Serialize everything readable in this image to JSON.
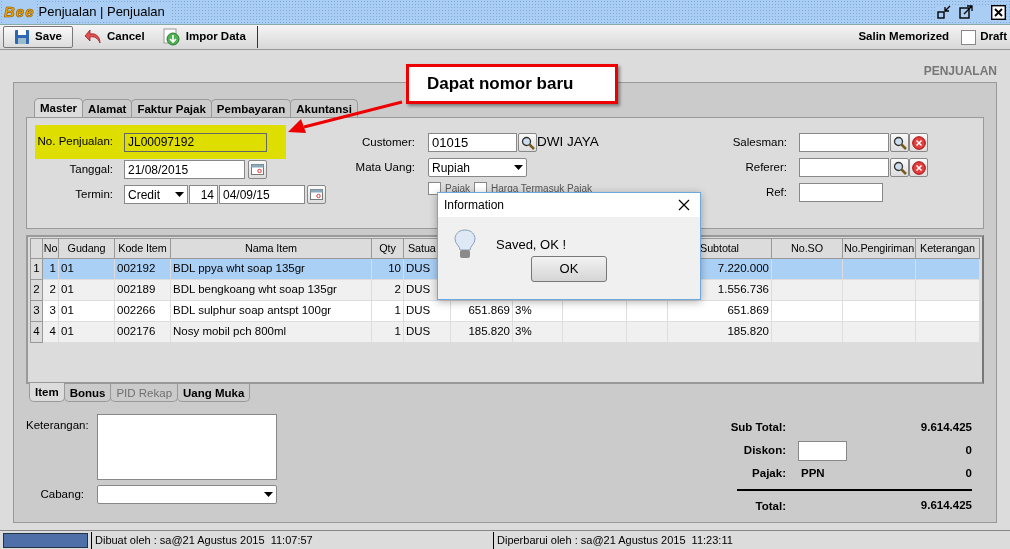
{
  "window": {
    "logo_text": "Bee",
    "title": "Penjualan | Penjualan"
  },
  "toolbar": {
    "buttons": [
      {
        "label": "Save",
        "kind": "save"
      },
      {
        "label": "Cancel",
        "kind": "cancel"
      },
      {
        "label": "Impor Data",
        "kind": "import"
      }
    ],
    "memorized_label": "Salin Memorized",
    "draft": {
      "label": "Draft",
      "checked": false
    }
  },
  "page_title": "PENJUALAN",
  "tabs": [
    {
      "label": "Master",
      "selected": true
    },
    {
      "label": "Alamat",
      "selected": false
    },
    {
      "label": "Faktur Pajak",
      "selected": false
    },
    {
      "label": "Pembayaran",
      "selected": false
    },
    {
      "label": "Akuntansi",
      "selected": false
    }
  ],
  "master": {
    "no_penjualan": {
      "label": "No. Penjualan:",
      "value": "JL00097192"
    },
    "tanggal": {
      "label": "Tanggal:",
      "value": "21/08/2015"
    },
    "termin": {
      "label": "Termin:",
      "type": "Credit",
      "days": "14",
      "due": "04/09/15"
    },
    "customer": {
      "label": "Customer:",
      "value": "01015",
      "name": "DWI JAYA"
    },
    "mata_uang": {
      "label": "Mata Uang:",
      "value": "Rupiah"
    },
    "checkboxes": [
      {
        "label": "Pajak",
        "checked": false
      },
      {
        "label": "Harga Termasuk Pajak",
        "checked": false
      }
    ],
    "salesman": {
      "label": "Salesman:"
    },
    "referer": {
      "label": "Referer:"
    },
    "ref": {
      "label": "Ref:"
    }
  },
  "table": {
    "columns": [
      "No",
      "Gudang",
      "Kode Item",
      "Nama Item",
      "Qty",
      "Satua",
      null,
      null,
      null,
      null,
      "Subtotal",
      "No.SO",
      "No.Pengiriman",
      "Keterangan"
    ],
    "rows": [
      {
        "row_header": "1",
        "selected": true,
        "cells": [
          "1",
          "01",
          "002192",
          "BDL ppya wht soap 135gr",
          "10",
          "DUS",
          null,
          null,
          null,
          null,
          "7.220.000",
          null,
          null,
          null
        ]
      },
      {
        "row_header": "2",
        "selected": false,
        "cells": [
          "2",
          "01",
          "002189",
          "BDL bengkoang wht soap 135gr",
          "2",
          "DUS",
          null,
          null,
          null,
          null,
          "1.556.736",
          null,
          null,
          null
        ]
      },
      {
        "row_header": "3",
        "selected": false,
        "cells": [
          "3",
          "01",
          "002266",
          "BDL sulphur soap antspt 100gr",
          "1",
          "DUS",
          "651.869",
          "3%",
          null,
          null,
          "651.869",
          null,
          null,
          null
        ]
      },
      {
        "row_header": "4",
        "selected": false,
        "cells": [
          "4",
          "01",
          "002176",
          "Nosy mobil pch 800ml",
          "1",
          "DUS",
          "185.820",
          "3%",
          null,
          null,
          "185.820",
          null,
          null,
          null
        ]
      }
    ]
  },
  "bottom_tabs": [
    {
      "label": "Item",
      "selected": true,
      "disabled": false
    },
    {
      "label": "Bonus",
      "selected": false,
      "disabled": false
    },
    {
      "label": "PID Rekap",
      "selected": false,
      "disabled": true
    },
    {
      "label": "Uang Muka",
      "selected": false,
      "disabled": false
    }
  ],
  "footer_form": {
    "keterangan_label": "Keterangan:",
    "cabang_label": "Cabang:"
  },
  "totals": [
    {
      "kind": "plain",
      "label": "Sub Total:",
      "value": "9.614.425"
    },
    {
      "kind": "input",
      "label": "Diskon:",
      "value": "0"
    },
    {
      "kind": "tax",
      "label": "Pajak:",
      "tax": "PPN",
      "value": "0"
    },
    {
      "kind": "total",
      "label": "Total:",
      "value": "9.614.425"
    }
  ],
  "status_bar": [
    "Dibuat oleh : sa@21 Agustus 2015  11:07:57",
    "Diperbarui oleh : sa@21 Agustus 2015  11:23:11"
  ],
  "dialog": {
    "title": "Information",
    "message": "Saved, OK !",
    "button": "OK"
  },
  "callout": {
    "text": "Dapat nomor baru"
  }
}
